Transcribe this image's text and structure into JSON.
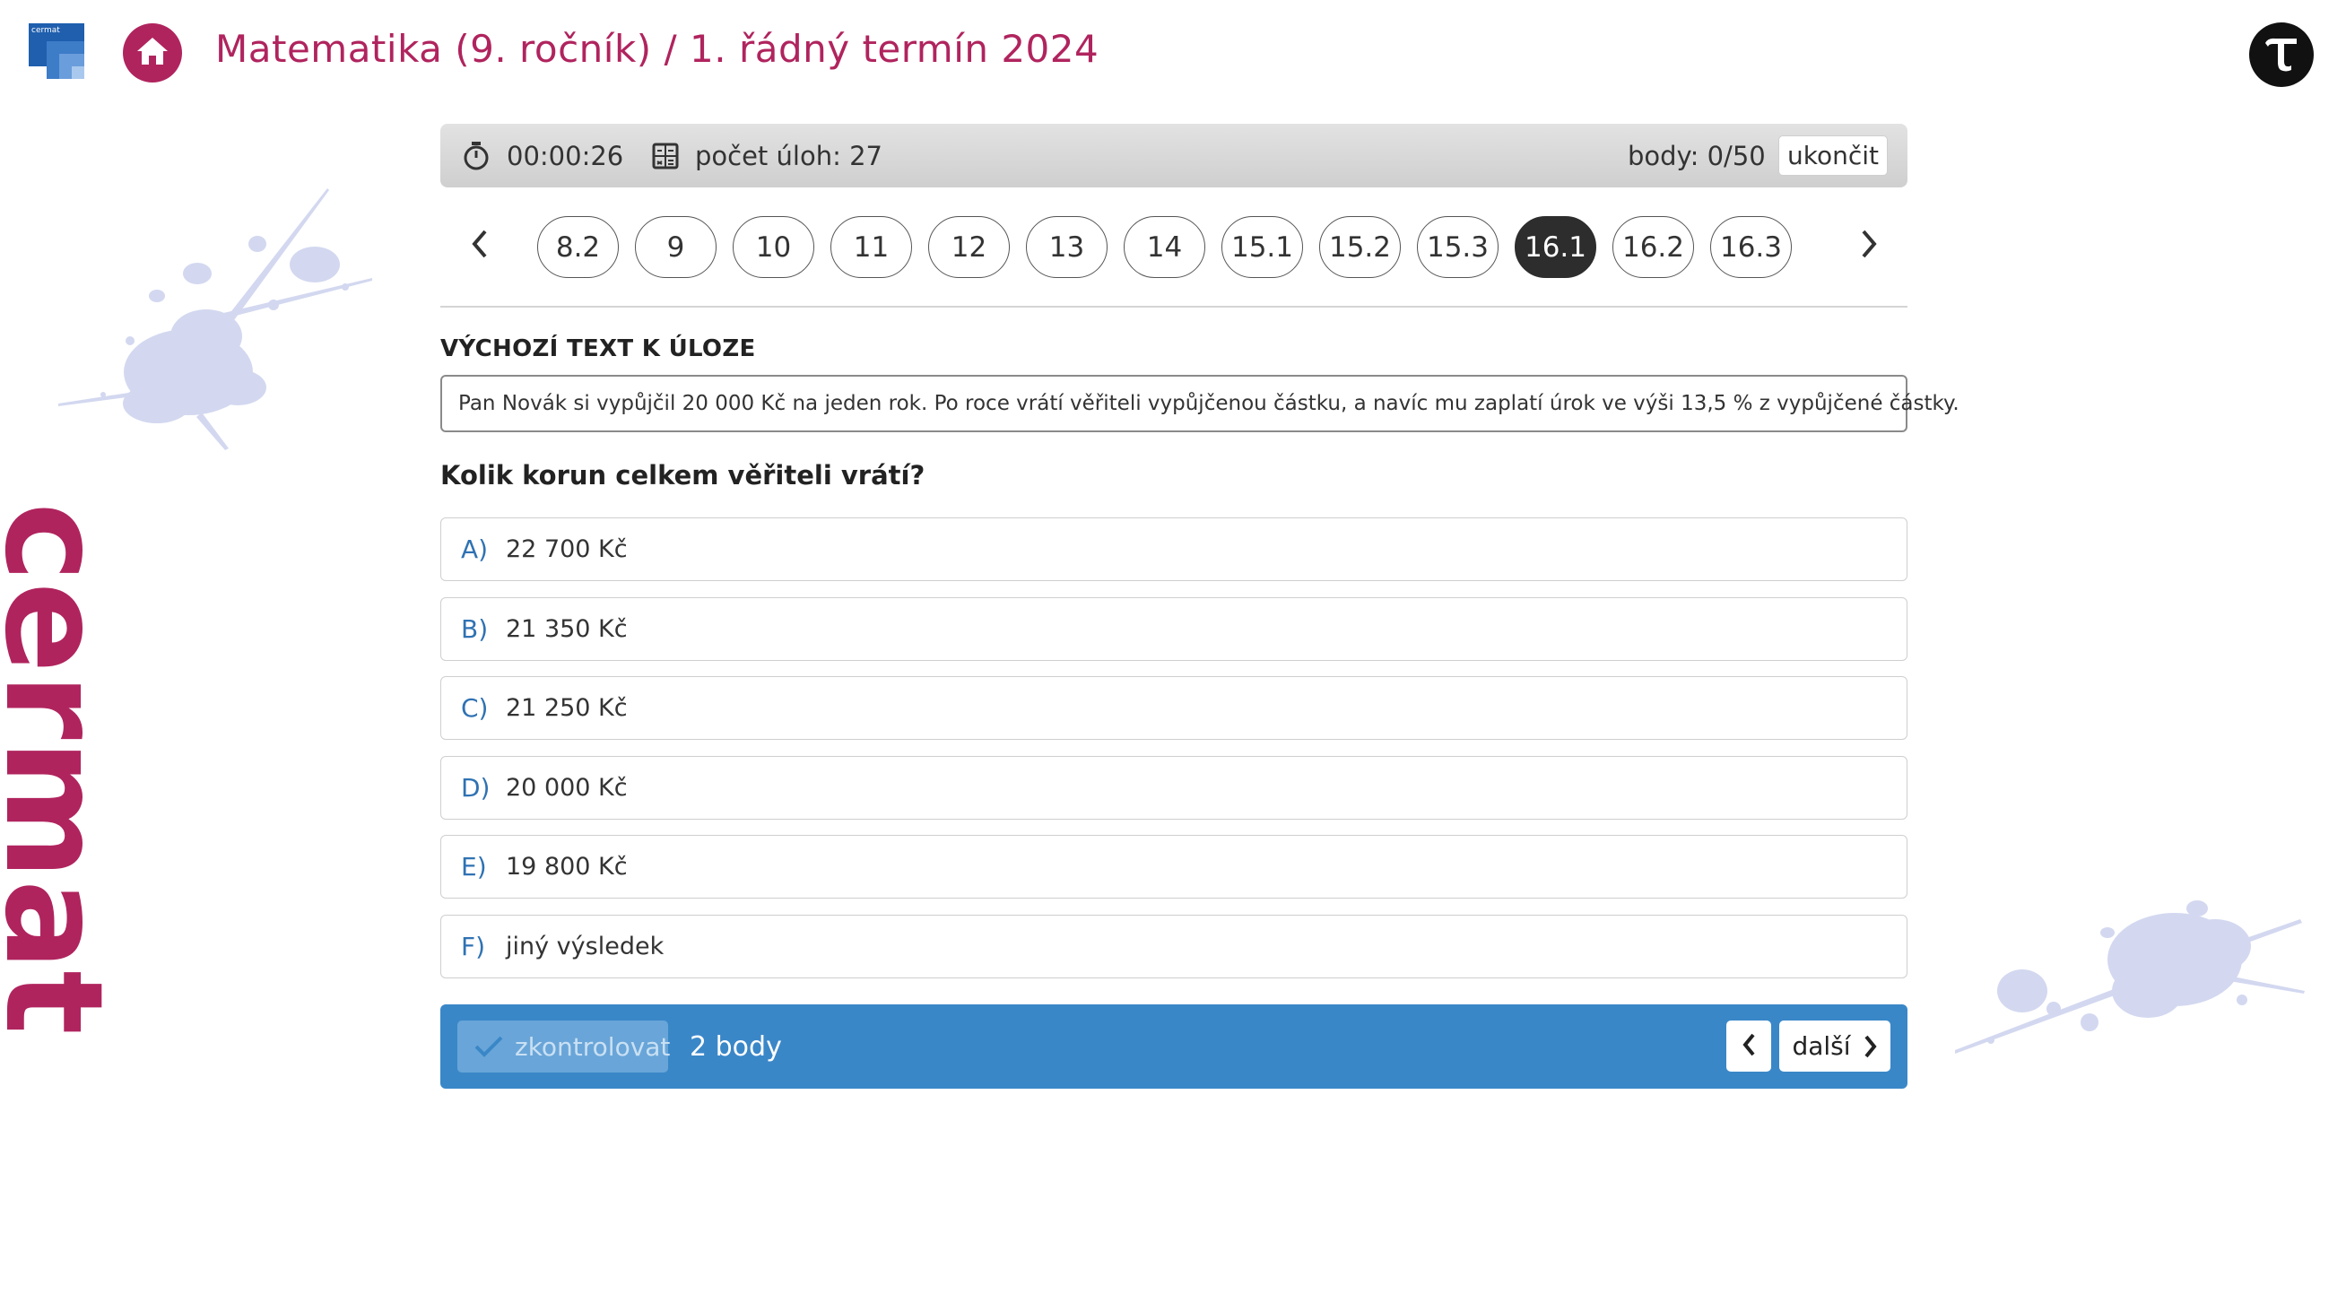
{
  "header": {
    "logo_text": "cermat",
    "title": "Matematika (9. ročník) / 1. řádný termín 2024"
  },
  "status_bar": {
    "timer": "00:00:26",
    "task_count": "počet úloh: 27",
    "score": "body: 0/50",
    "end_label": "ukončit"
  },
  "task_nav": {
    "items": [
      "8.2",
      "9",
      "10",
      "11",
      "12",
      "13",
      "14",
      "15.1",
      "15.2",
      "15.3",
      "16.1",
      "16.2",
      "16.3"
    ],
    "active": "16.1"
  },
  "task": {
    "section_label": "VÝCHOZÍ TEXT K ÚLOZE",
    "source_text": "Pan Novák si vypůjčil 20 000 Kč na jeden rok. Po roce vrátí věřiteli vypůjčenou částku, a navíc mu zaplatí úrok ve výši 13,5 % z vypůjčené částky.",
    "question": "Kolik korun celkem věřiteli vrátí?",
    "options": [
      {
        "letter": "A)",
        "text": "22 700 Kč"
      },
      {
        "letter": "B)",
        "text": "21 350 Kč"
      },
      {
        "letter": "C)",
        "text": "21 250 Kč"
      },
      {
        "letter": "D)",
        "text": "20 000 Kč"
      },
      {
        "letter": "E)",
        "text": "19 800 Kč"
      },
      {
        "letter": "F)",
        "text": "jiný výsledek"
      }
    ]
  },
  "action_bar": {
    "check_label": "zkontrolovat",
    "points": "2 body",
    "next_label": "další"
  },
  "decor": {
    "vertical_brand": "cermat"
  },
  "colors": {
    "brand": "#b0245e",
    "accent_blue": "#3a87c8",
    "active_pill": "#2d2d2d"
  },
  "icons": [
    "cermat-logo",
    "home-icon",
    "tau-icon",
    "stopwatch-icon",
    "calculator-icon",
    "chevron-left-icon",
    "chevron-right-icon",
    "check-icon"
  ]
}
